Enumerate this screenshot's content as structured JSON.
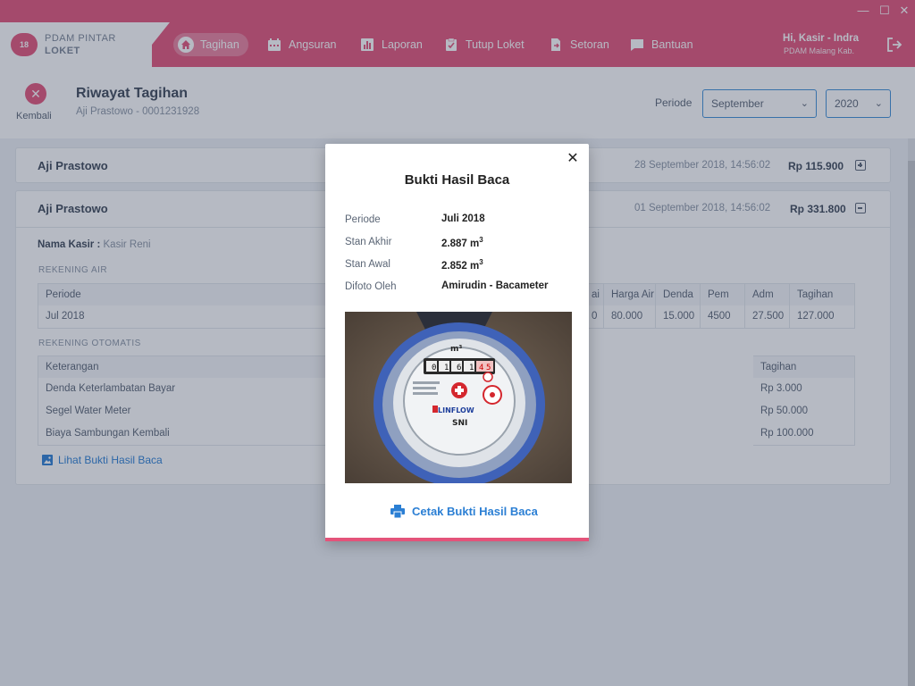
{
  "window": {
    "minimize": "—",
    "maximize": "☐",
    "close": "✕"
  },
  "brand": {
    "mark": "18",
    "line1": "PDAM PINTAR",
    "line2": "LOKET"
  },
  "nav": {
    "items": [
      {
        "label": "Tagihan",
        "icon": "home-icon",
        "active": true
      },
      {
        "label": "Angsuran",
        "icon": "calendar-icon"
      },
      {
        "label": "Laporan",
        "icon": "bar-chart-icon"
      },
      {
        "label": "Tutup Loket",
        "icon": "clipboard-check-icon"
      },
      {
        "label": "Setoran",
        "icon": "file-send-icon"
      },
      {
        "label": "Bantuan",
        "icon": "chat-icon"
      }
    ]
  },
  "user": {
    "greeting": "Hi, Kasir - Indra",
    "org": "PDAM Malang Kab."
  },
  "header": {
    "back_label": "Kembali",
    "title": "Riwayat Tagihan",
    "subtitle": "Aji Prastowo - 0001231928",
    "periode_label": "Periode",
    "month": "September",
    "year": "2020"
  },
  "records": [
    {
      "name": "Aji Prastowo",
      "date": "28 September 2018, 14:56:02",
      "amount": "Rp 115.900",
      "expanded": false
    },
    {
      "name": "Aji Prastowo",
      "date": "01 September 2018, 14:56:02",
      "amount": "Rp 331.800",
      "expanded": true
    }
  ],
  "detail": {
    "kasir_label": "Nama Kasir :",
    "kasir_value": "Kasir Reni",
    "rekening_air": {
      "label": "REKENING AIR",
      "headers_left": [
        "Periode"
      ],
      "headers_right": [
        "ai",
        "Harga Air",
        "Denda",
        "Pem",
        "Adm",
        "Tagihan"
      ],
      "row_left": [
        "Jul 2018"
      ],
      "row_right": [
        "0",
        "80.000",
        "15.000",
        "4500",
        "27.500",
        "127.000"
      ]
    },
    "rekening_otomatis": {
      "label": "REKENING OTOMATIS",
      "header_left": "Keterangan",
      "header_right": "Tagihan",
      "rows": [
        {
          "keterangan": "Denda Keterlambatan Bayar",
          "tagihan": "Rp 3.000"
        },
        {
          "keterangan": "Segel Water Meter",
          "tagihan": "Rp 50.000"
        },
        {
          "keterangan": "Biaya Sambungan Kembali",
          "tagihan": "Rp 100.000"
        }
      ]
    },
    "link_label": "Lihat Bukti Hasil Baca"
  },
  "modal": {
    "title": "Bukti Hasil Baca",
    "fields": [
      {
        "label": "Periode",
        "value": "Juli 2018",
        "sup": ""
      },
      {
        "label": "Stan Akhir",
        "value": "2.887 m",
        "sup": "3"
      },
      {
        "label": "Stan Awal",
        "value": "2.852 m",
        "sup": "3"
      },
      {
        "label": "Difoto Oleh",
        "value": "Amirudin - Bacameter",
        "sup": ""
      }
    ],
    "photo": {
      "brand": "LINFLOW",
      "reading": "0161",
      "reading_red": "45",
      "unit": "m³",
      "mark": "SNI"
    },
    "print_label": "Cetak Bukti Hasil Baca"
  },
  "colors": {
    "accent": "#e4537a",
    "link": "#2b7fd4",
    "border_select": "#3e8fd8"
  }
}
